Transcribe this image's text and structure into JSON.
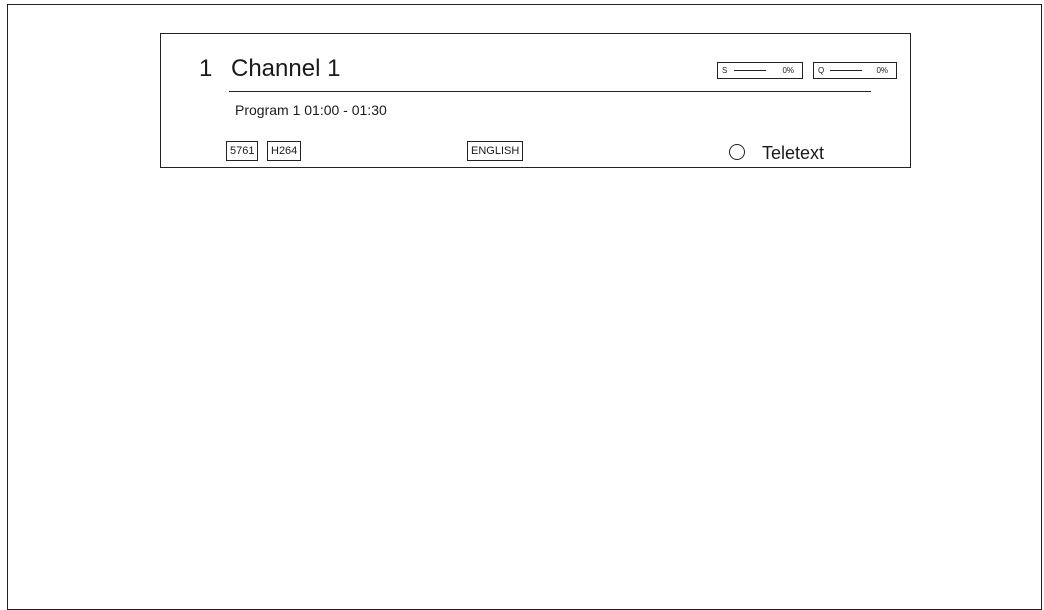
{
  "channel": {
    "number": "1",
    "name": "Channel 1"
  },
  "signal": {
    "strength_label": "S",
    "strength_value": "0%",
    "quality_label": "Q",
    "quality_value": "0%"
  },
  "program": {
    "title": "Program 1",
    "time": "01:00 - 01:30"
  },
  "tags": {
    "pid": "5761",
    "codec": "H264",
    "audio_language": "ENGLISH"
  },
  "teletext": {
    "label": "Teletext"
  },
  "icons": {
    "teletext_indicator": "circle-outline-icon"
  }
}
